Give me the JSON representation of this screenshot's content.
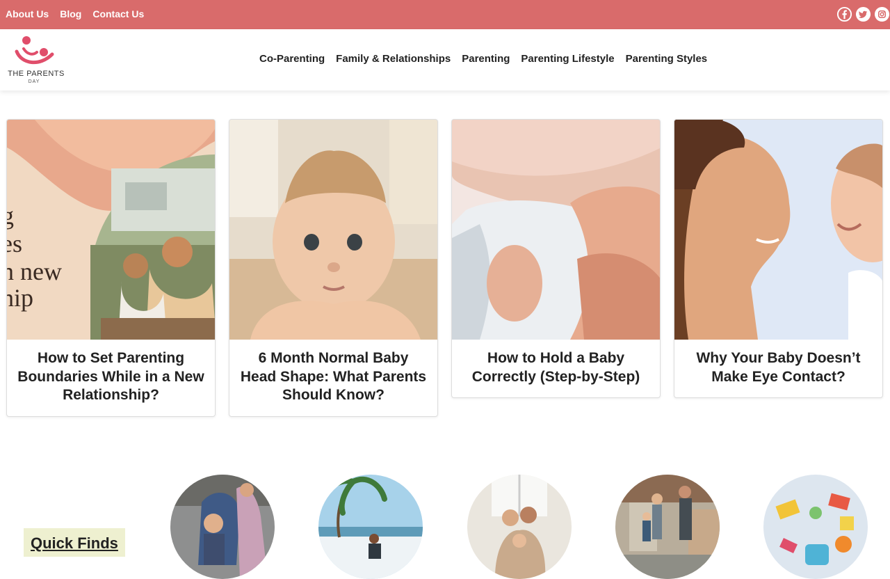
{
  "topbar": {
    "links": [
      "About Us",
      "Blog",
      "Contact Us"
    ],
    "social_icons": [
      "facebook-icon",
      "twitter-icon",
      "instagram-icon"
    ]
  },
  "logo": {
    "name": "THE PARENTS",
    "sub": "DAY",
    "color": "#e04e6b"
  },
  "nav": {
    "items": [
      "Co-Parenting",
      "Family & Relationships",
      "Parenting",
      "Parenting Lifestyle",
      "Parenting Styles"
    ]
  },
  "cards": [
    {
      "title": "How to Set Parenting Boundaries While in a New Relationship?",
      "image_text": [
        "g",
        "es",
        "n new",
        "hip"
      ]
    },
    {
      "title": "6 Month Normal Baby Head Shape: What Parents Should Know?"
    },
    {
      "title": "How to Hold a Baby Correctly (Step-by-Step)"
    },
    {
      "title": "Why Your Baby Doesn’t Make Eye Contact?"
    }
  ],
  "quick_finds": {
    "label": "Quick Finds"
  },
  "colors": {
    "topbar": "#d96b6b",
    "quick_finds_bg": "#eef0d0"
  }
}
